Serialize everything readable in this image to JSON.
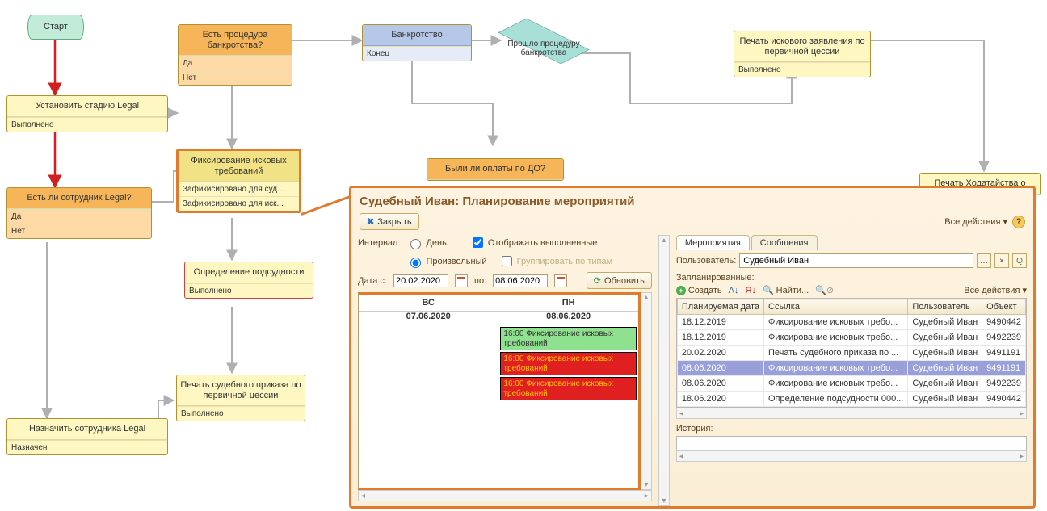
{
  "flow": {
    "start": "Старт",
    "set_stage": {
      "title": "Установить стадию Legal",
      "status": "Выполнено"
    },
    "has_legal_emp": {
      "title": "Есть ли сотрудник Legal?",
      "yes": "Да",
      "no": "Нет"
    },
    "has_bankruptcy": {
      "title": "Есть процедура банкротства?",
      "yes": "Да",
      "no": "Нет"
    },
    "bankruptcy": {
      "title": "Банкротство",
      "status": "Конец"
    },
    "diamond": "Прошло процедуру\nбанкротства",
    "print_claim_primary": {
      "title": "Печать искового заявления по первичной цессии",
      "status": "Выполнено"
    },
    "fix_claims": {
      "title": "Фиксирование исковых требований",
      "r1": "Зафикисировано для суд...",
      "r2": "Зафикисировано для иск..."
    },
    "were_payments_do": {
      "title": "Были ли оплаты по ДО?"
    },
    "print_motion": {
      "title": "Печать Ходатайства о"
    },
    "define_jurisdiction": {
      "title": "Определение подсудности",
      "status": "Выполнено"
    },
    "print_order_primary": {
      "title": "Печать судебного приказа по первичной цессии",
      "status": "Выполнено"
    },
    "assign_legal_emp": {
      "title": "Назначить сотрудника Legal",
      "status": "Назначен"
    }
  },
  "planner": {
    "title": "Судебный Иван: Планирование мероприятий",
    "close": "Закрыть",
    "all_actions": "Все действия",
    "interval_label": "Интервал:",
    "interval_day": "День",
    "interval_arbitrary": "Произвольный",
    "show_done": "Отображать выполненные",
    "group_by_type": "Группировать по типам",
    "date_from_label": "Дата с:",
    "date_to_label": "по:",
    "date_from": "20.02.2020",
    "date_to": "08.06.2020",
    "refresh": "Обновить",
    "calendar": {
      "cols": [
        {
          "dow": "ВС",
          "date": "07.06.2020",
          "events": []
        },
        {
          "dow": "ПН",
          "date": "08.06.2020",
          "events": [
            {
              "color": "green",
              "text": "16:00 Фиксирование исковых требований"
            },
            {
              "color": "red",
              "text": "16:00 Фиксирование исковых требований"
            },
            {
              "color": "red",
              "text": "16:00 Фиксирование исковых требований"
            }
          ]
        }
      ]
    },
    "tabs": {
      "events": "Мероприятия",
      "messages": "Сообщения"
    },
    "user_label": "Пользователь:",
    "user_value": "Судебный Иван",
    "scheduled_label": "Запланированные:",
    "create": "Создать",
    "find": "Найти...",
    "history_label": "История:",
    "columns": {
      "date": "Планируемая дата",
      "ref": "Ссылка",
      "user": "Пользователь",
      "obj": "Объект"
    },
    "rows": [
      {
        "date": "18.12.2019",
        "ref": "Фиксирование исковых требо...",
        "user": "Судебный Иван",
        "obj": "9490442"
      },
      {
        "date": "18.12.2019",
        "ref": "Фиксирование исковых требо...",
        "user": "Судебный Иван",
        "obj": "9492239"
      },
      {
        "date": "20.02.2020",
        "ref": "Печать судебного приказа по ...",
        "user": "Судебный Иван",
        "obj": "9491191"
      },
      {
        "date": "08.06.2020",
        "ref": "Фиксирование исковых требо...",
        "user": "Судебный Иван",
        "obj": "9491191",
        "selected": true
      },
      {
        "date": "08.06.2020",
        "ref": "Фиксирование исковых требо...",
        "user": "Судебный Иван",
        "obj": "9492239"
      },
      {
        "date": "18.06.2020",
        "ref": "Определение подсудности 000...",
        "user": "Судебный Иван",
        "obj": "9490442"
      }
    ]
  }
}
